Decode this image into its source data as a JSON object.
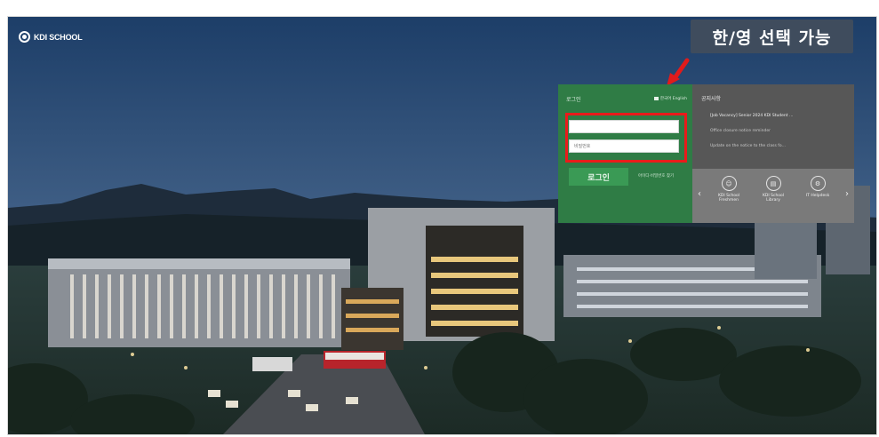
{
  "logo": {
    "text": "KDI SCHOOL"
  },
  "annotation": {
    "text": "한/영 선택 가능"
  },
  "login": {
    "title": "로그인",
    "language_label": "한국어 English",
    "id_value": "",
    "password_placeholder": "비밀번호",
    "button_label": "로그인",
    "forgot_label": "아이디·비밀번호 찾기"
  },
  "notices": {
    "title": "공지사항",
    "items": [
      "[Job Vacancy] Senior 2024 KDI Student …",
      "Office closure notice reminder",
      "Update on the notice to the class fo…"
    ]
  },
  "quick_links": [
    {
      "icon": "student-icon",
      "label": "KDI School Freshmen"
    },
    {
      "icon": "library-icon",
      "label": "KDI School Library"
    },
    {
      "icon": "helpdesk-icon",
      "label": "IT Helpdesk"
    }
  ],
  "colors": {
    "login_panel": "#2f7c45",
    "notice_panel": "#575757",
    "quick_panel": "#7a7a7a",
    "highlight": "#ea1b1b",
    "annotation_bg": "#3f4c5d"
  }
}
